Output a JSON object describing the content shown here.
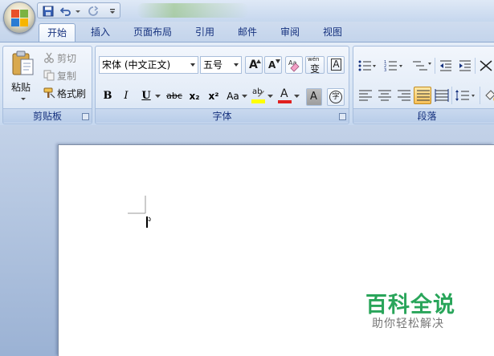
{
  "tabs": [
    {
      "label": "开始",
      "active": true
    },
    {
      "label": "插入"
    },
    {
      "label": "页面布局"
    },
    {
      "label": "引用"
    },
    {
      "label": "邮件"
    },
    {
      "label": "审阅"
    },
    {
      "label": "视图"
    }
  ],
  "clipboard": {
    "paste_label": "粘贴",
    "cut_label": "剪切",
    "copy_label": "复制",
    "format_painter_label": "格式刷",
    "group_label": "剪贴板"
  },
  "font": {
    "font_name": "宋体 (中文正文)",
    "font_size": "五号",
    "grow_label": "A",
    "shrink_label": "A",
    "phonetic_label": "wén",
    "phonetic_char": "变",
    "border_char": "A",
    "bold": "B",
    "italic": "I",
    "underline": "U",
    "strike": "abc",
    "subscript": "x₂",
    "superscript": "x²",
    "change_case": "Aa",
    "highlight": "ab",
    "font_color": "A",
    "shading_char": "A",
    "enclose_char": "字",
    "group_label": "字体"
  },
  "paragraph": {
    "group_label": "段落"
  },
  "colors": {
    "accent": "#15317e",
    "highlight": "#ffff00",
    "font_color": "#e02020",
    "watermark_green": "#29a55a"
  },
  "watermark": {
    "title": "百科全说",
    "subtitle": "助你轻松解决"
  }
}
